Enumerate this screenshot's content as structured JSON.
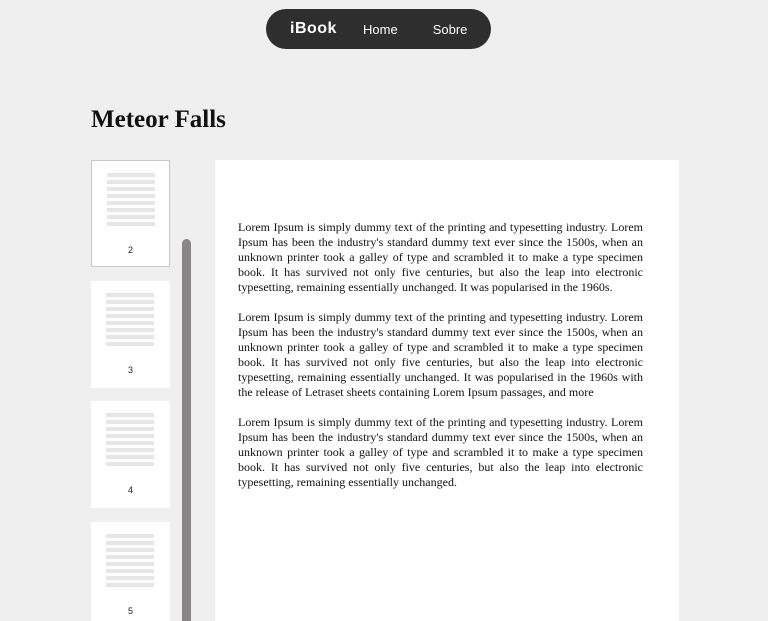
{
  "nav": {
    "logo": "iBook",
    "links": [
      {
        "label": "Home"
      },
      {
        "label": "Sobre"
      }
    ]
  },
  "book": {
    "title": "Meteor Falls"
  },
  "thumbnails": [
    {
      "page": "2",
      "selected": true
    },
    {
      "page": "3",
      "selected": false
    },
    {
      "page": "4",
      "selected": false
    },
    {
      "page": "5",
      "selected": false
    }
  ],
  "scrollbar": {
    "position": 0.17
  },
  "content": {
    "paragraphs": [
      "Lorem Ipsum is simply dummy text of the printing and typesetting industry. Lorem Ipsum has been the industry's standard dummy text ever since the 1500s, when an unknown printer took a galley of type and scrambled it to make a type specimen book. It has survived not only five centuries, but also the leap into electronic typesetting, remaining essentially unchanged. It was popularised in the 1960s.",
      "Lorem Ipsum is simply dummy text of the printing and typesetting industry. Lorem Ipsum has been the industry's standard dummy text ever since the 1500s, when an unknown printer took a galley of type and scrambled it to make a type specimen book. It has survived not only five centuries, but also the leap into electronic typesetting, remaining essentially unchanged. It was popularised in the 1960s with the release of Letraset sheets containing Lorem Ipsum passages, and more",
      "Lorem Ipsum is simply dummy text of the printing and typesetting industry. Lorem Ipsum has been the industry's standard dummy text ever since the 1500s, when an unknown printer took a galley of type and scrambled it to make a type specimen book. It has survived not only five centuries, but also the leap into electronic typesetting, remaining essentially unchanged."
    ]
  },
  "colors": {
    "background": "#efefef",
    "nav_bg": "#2e2e2e",
    "scroll_thumb": "#8a8686"
  }
}
